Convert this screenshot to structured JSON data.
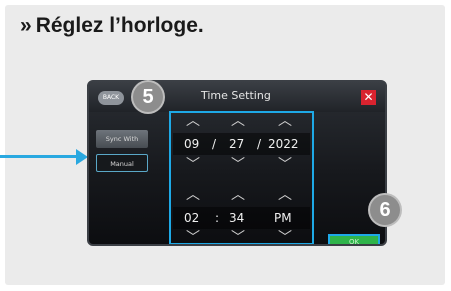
{
  "heading": {
    "chevron": "»",
    "text": "Réglez l’horloge."
  },
  "screen": {
    "back_label": "BACK",
    "title": "Time Setting",
    "close_icon": "✕",
    "sync_label": "Sync With Phone",
    "manual_label": "Manual",
    "date": {
      "month": "09",
      "sep1": "/",
      "day": "27",
      "sep2": "/",
      "year": "2022"
    },
    "time": {
      "hour": "02",
      "sep": ":",
      "minute": "34",
      "ampm": "PM"
    },
    "ok_label": "OK",
    "up_glyph": "^",
    "down_glyph": "v"
  },
  "callouts": {
    "step5": "5",
    "step6": "6"
  },
  "colors": {
    "highlight": "#1ea9e6",
    "pointer": "#29a8e0",
    "close": "#d9232f",
    "ok": "#2fb44a"
  }
}
